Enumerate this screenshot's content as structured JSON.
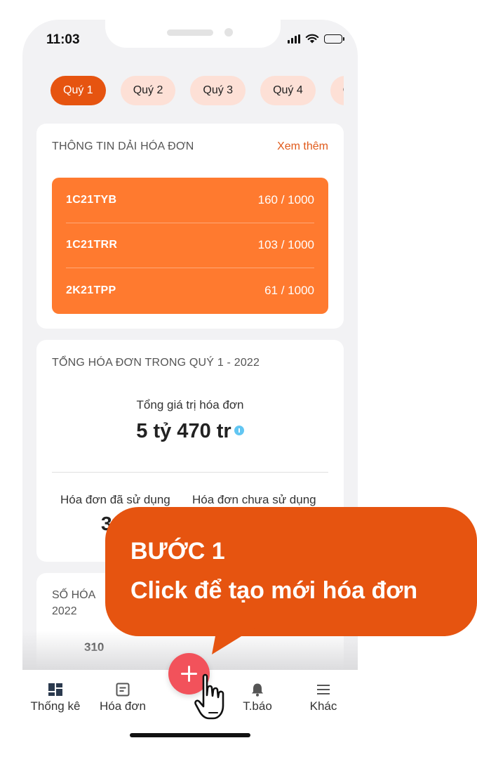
{
  "status_bar": {
    "time": "11:03"
  },
  "quarter_tabs": [
    "Quý 1",
    "Quý 2",
    "Quý 3",
    "Quý 4",
    "C"
  ],
  "invoice_ranges_card": {
    "title": "THÔNG TIN DẢI HÓA ĐƠN",
    "see_more": "Xem thêm",
    "ranges": [
      {
        "code": "1C21TYB",
        "usage": "160 / 1000"
      },
      {
        "code": "1C21TRR",
        "usage": "103 / 1000"
      },
      {
        "code": "2K21TPP",
        "usage": "61 / 1000"
      }
    ]
  },
  "totals_card": {
    "title": "TỔNG HÓA ĐƠN TRONG QUÝ 1 - 2022",
    "total_label": "Tổng giá trị hóa đơn",
    "total_value": "5 tỷ 470 tr",
    "used_label": "Hóa đơn đã sử dụng",
    "unused_label": "Hóa đơn chưa sử dụng",
    "used_value_partial": "3"
  },
  "count_card": {
    "title": "SỐ HÓA ĐƠN ... 2022",
    "title_line1": "SỐ HÓA",
    "title_line2": "2022",
    "bar_value": "310"
  },
  "bottom_nav": [
    {
      "label": "Thống kê",
      "icon": "dashboard-icon"
    },
    {
      "label": "Hóa đơn",
      "icon": "invoice-icon"
    },
    {
      "label": "T.báo",
      "icon": "bell-icon"
    },
    {
      "label": "Khác",
      "icon": "menu-icon"
    }
  ],
  "fab": {
    "icon": "plus-icon"
  },
  "callout": {
    "step": "BƯỚC 1",
    "text": "Click để tạo mới hóa đơn"
  },
  "colors": {
    "accent": "#e65410",
    "range_card": "#ff7a2f",
    "fab": "#f2525b",
    "tab_inactive": "#fde0d6",
    "info": "#62c6f2"
  }
}
